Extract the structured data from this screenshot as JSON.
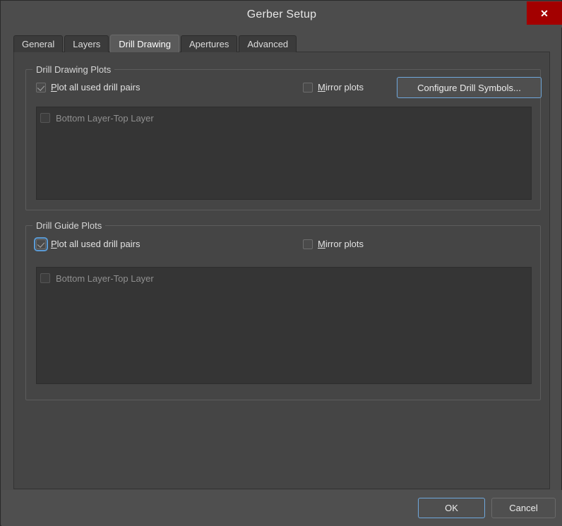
{
  "window": {
    "title": "Gerber Setup",
    "close_label": "✕",
    "accent_blue": "#6fa8dc",
    "close_red": "#a30000",
    "background": "#4c4c4c"
  },
  "tabs": [
    {
      "label": "General",
      "active": false
    },
    {
      "label": "Layers",
      "active": false
    },
    {
      "label": "Drill Drawing",
      "active": true
    },
    {
      "label": "Apertures",
      "active": false
    },
    {
      "label": "Advanced",
      "active": false
    }
  ],
  "drill_drawing_plots": {
    "title": "Drill Drawing Plots",
    "plot_all_label_mnemonic": "P",
    "plot_all_label_rest": "lot all used drill pairs",
    "plot_all_checked": true,
    "plot_all_focused": false,
    "mirror_label_mnemonic": "M",
    "mirror_label_rest": "irror plots",
    "mirror_checked": false,
    "configure_button_label": "Configure Drill Symbols...",
    "list_items": [
      {
        "label": "Bottom Layer-Top Layer",
        "checked": false,
        "enabled": false
      }
    ]
  },
  "drill_guide_plots": {
    "title": "Drill Guide Plots",
    "plot_all_label_mnemonic": "P",
    "plot_all_label_rest": "lot all used drill pairs",
    "plot_all_checked": true,
    "plot_all_focused": true,
    "mirror_label_mnemonic": "M",
    "mirror_label_rest": "irror plots",
    "mirror_checked": false,
    "list_items": [
      {
        "label": "Bottom Layer-Top Layer",
        "checked": false,
        "enabled": false
      }
    ]
  },
  "footer": {
    "ok_label": "OK",
    "cancel_label": "Cancel"
  }
}
